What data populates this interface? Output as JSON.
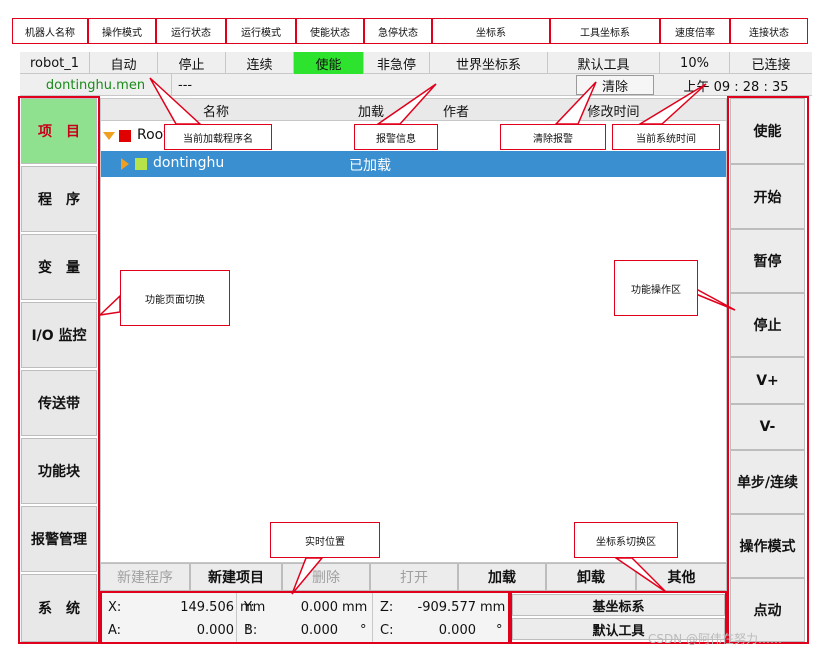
{
  "header": {
    "robot_name": "机器人名称",
    "op_mode": "操作模式",
    "run_state": "运行状态",
    "run_mode": "运行模式",
    "enable_state": "使能状态",
    "estop_state": "急停状态",
    "coord_sys": "坐标系",
    "tool_coord": "工具坐标系",
    "speed_rate": "速度倍率",
    "connection": "连接状态"
  },
  "status": {
    "robot_name": "robot_1",
    "op_mode": "自动",
    "run_state": "停止",
    "run_mode": "连续",
    "enable_state": "使能",
    "estop_state": "非急停",
    "coord_sys": "世界坐标系",
    "tool_coord": "默认工具",
    "speed_rate": "10%",
    "connection": "已连接"
  },
  "info": {
    "program_name": "dontinghu.men",
    "alarm_text": "---",
    "clear_button": "清除",
    "time": "上午  09 : 28 : 35"
  },
  "nav": [
    "项　目",
    "程　序",
    "变　量",
    "I/O 监控",
    "传送带",
    "功能块",
    "报警管理",
    "系　统"
  ],
  "table": {
    "columns": [
      "名称",
      "加载",
      "作者",
      "修改时间"
    ],
    "rows": [
      {
        "name": "Root",
        "loaded": "",
        "author": "",
        "time": ""
      },
      {
        "name": "dontinghu",
        "loaded": "已加载",
        "author": "",
        "time": ""
      }
    ]
  },
  "right_buttons": [
    "使能",
    "开始",
    "暂停",
    "停止",
    "V+",
    "V-",
    "单步/连续",
    "操作模式",
    "点动"
  ],
  "bottom_buttons": [
    "新建程序",
    "新建项目",
    "删除",
    "打开",
    "加载",
    "卸载",
    "其他"
  ],
  "position": {
    "x_label": "X:",
    "x_value": "149.506",
    "x_unit": "mm",
    "y_label": "Y:",
    "y_value": "0.000",
    "y_unit": "mm",
    "z_label": "Z:",
    "z_value": "-909.577",
    "z_unit": "mm",
    "a_label": "A:",
    "a_value": "0.000",
    "a_unit": "°",
    "b_label": "B:",
    "b_value": "0.000",
    "b_unit": "°",
    "c_label": "C:",
    "c_value": "0.000",
    "c_unit": "°"
  },
  "coord_switch": {
    "base": "基坐标系",
    "tool": "默认工具"
  },
  "annotations": {
    "program_name": "当前加载程序名",
    "alarm_info": "报警信息",
    "clear_alarm": "清除报警",
    "sys_time": "当前系统时间",
    "page_switch": "功能页面切换",
    "op_area": "功能操作区",
    "realtime_pos": "实时位置",
    "coord_area": "坐标系切换区"
  },
  "watermark": "CSDN @阿伟在努力……",
  "colors": {
    "enable_green": "#2ee32e",
    "selected_blue": "#3a8fd0",
    "annotation_red": "#e0001b",
    "active_nav": "#8fe08f",
    "program_green": "#1a8a1a"
  }
}
